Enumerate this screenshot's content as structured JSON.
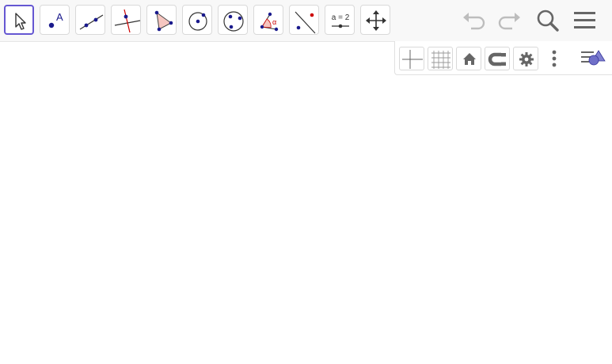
{
  "toolbar": {
    "tools": [
      {
        "id": "move",
        "icon": "cursor-arrow-icon",
        "selected": true
      },
      {
        "id": "point",
        "icon": "point-icon",
        "label": "A"
      },
      {
        "id": "line",
        "icon": "line-through-two-points-icon"
      },
      {
        "id": "perpendicular-line",
        "icon": "perpendicular-line-icon"
      },
      {
        "id": "polygon",
        "icon": "polygon-icon"
      },
      {
        "id": "circle-center-point",
        "icon": "circle-center-point-icon"
      },
      {
        "id": "circle-three-points",
        "icon": "circle-three-points-icon"
      },
      {
        "id": "angle",
        "icon": "angle-icon",
        "label": "α"
      },
      {
        "id": "reflect-about-line",
        "icon": "reflect-about-line-icon"
      },
      {
        "id": "slider",
        "icon": "slider-icon",
        "label": "a = 2"
      },
      {
        "id": "move-graphics-view",
        "icon": "move-graphics-view-icon"
      }
    ],
    "header_buttons": [
      {
        "id": "undo",
        "icon": "undo-icon",
        "enabled": false
      },
      {
        "id": "redo",
        "icon": "redo-icon",
        "enabled": false
      },
      {
        "id": "search",
        "icon": "search-icon"
      },
      {
        "id": "menu",
        "icon": "menu-icon"
      }
    ]
  },
  "style_bar": {
    "buttons": [
      {
        "id": "axes-toggle",
        "icon": "axes-icon"
      },
      {
        "id": "grid-toggle",
        "icon": "grid-icon"
      },
      {
        "id": "standard-view",
        "icon": "home-icon"
      },
      {
        "id": "point-capturing",
        "icon": "point-capturing-icon"
      },
      {
        "id": "settings",
        "icon": "gear-icon"
      },
      {
        "id": "more",
        "icon": "more-vertical-icon"
      },
      {
        "id": "toggle-style-bar",
        "icon": "style-bar-toggle-icon"
      }
    ]
  },
  "colors": {
    "toolbar_bg": "#f8f8f8",
    "selected_border": "#6557d2",
    "point": "#1a1a8c",
    "line": "#333333",
    "accent_red": "#cc0000",
    "polygon_fill": "#f6c6c0",
    "icon_gray": "#666666",
    "disabled": "#bdbdbd"
  }
}
